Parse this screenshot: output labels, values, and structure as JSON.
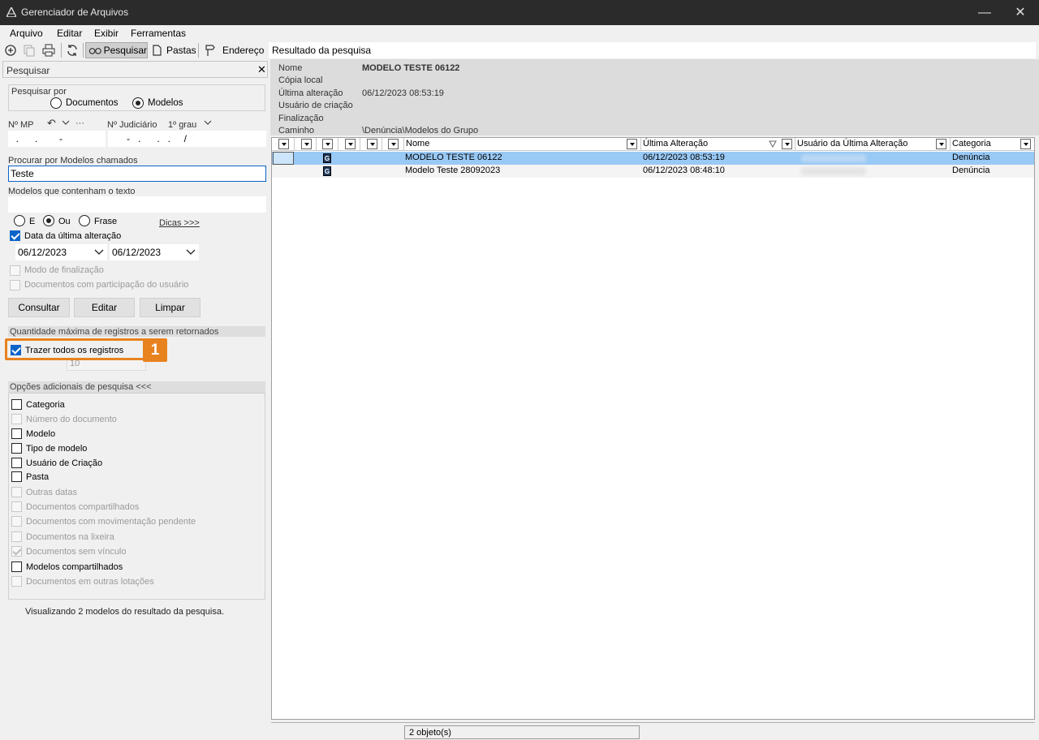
{
  "window": {
    "title": "Gerenciador de Arquivos"
  },
  "menu": [
    "Arquivo",
    "Editar",
    "Exibir",
    "Ferramentas"
  ],
  "toolbar": {
    "pesquisar": "Pesquisar",
    "pastas": "Pastas",
    "endereco": "Endereço",
    "address_value": "Resultado da pesquisa"
  },
  "search": {
    "panel_title": "Pesquisar",
    "search_by_label": "Pesquisar por",
    "radio_documentos": "Documentos",
    "radio_modelos": "Modelos",
    "nmp_label": "Nº MP",
    "nmp_ellipsis": "···",
    "njud_label": "Nº Judiciário",
    "grau": "1º grau",
    "nmp_value": "  .      .        -",
    "njud_value": "      -   .      .   .     /",
    "models_named_label": "Procurar por Modelos chamados",
    "models_named_value": "Teste",
    "text_label": "Modelos que contenham o texto",
    "text_value": "",
    "radio_e": "E",
    "radio_ou": "Ou",
    "radio_frase": "Frase",
    "dicas": "Dicas >>>",
    "date_cb_label": "Data da última alteração",
    "date_from": "06/12/2023",
    "date_to": "06/12/2023",
    "modo_final": "Modo de finalização",
    "docs_participacao": "Documentos com participação do usuário",
    "btn_consultar": "Consultar",
    "btn_editar": "Editar",
    "btn_limpar": "Limpar",
    "max_records_label": "Quantidade máxima de registros a serem retornados",
    "trazer_todos": "Trazer todos os registros",
    "max_value": "10",
    "step_badge": "1",
    "opcoes_header": "Opções adicionais de pesquisa <<<",
    "options": [
      {
        "label": "Categoria",
        "enabled": true,
        "checked": false
      },
      {
        "label": "Número do documento",
        "enabled": false,
        "checked": false
      },
      {
        "label": "Modelo",
        "enabled": true,
        "checked": false
      },
      {
        "label": "Tipo de modelo",
        "enabled": true,
        "checked": false
      },
      {
        "label": "Usuário de Criação",
        "enabled": true,
        "checked": false
      },
      {
        "label": "Pasta",
        "enabled": true,
        "checked": false
      },
      {
        "label": "Outras datas",
        "enabled": false,
        "checked": false
      },
      {
        "label": "Documentos compartilhados",
        "enabled": false,
        "checked": false
      },
      {
        "label": "Documentos com movimentação pendente",
        "enabled": false,
        "checked": false
      },
      {
        "label": "Documentos na lixeira",
        "enabled": false,
        "checked": false
      },
      {
        "label": "Documentos sem vínculo",
        "enabled": false,
        "checked": true
      },
      {
        "label": "Modelos compartilhados",
        "enabled": true,
        "checked": false
      },
      {
        "label": "Documentos em outras lotações",
        "enabled": false,
        "checked": false
      }
    ],
    "result_summary": "Visualizando 2 modelos do resultado da pesquisa."
  },
  "details": {
    "nome_label": "Nome",
    "nome_value": "MODELO TESTE 06122",
    "copia_label": "Cópia local",
    "ultima_label": "Última alteração",
    "ultima_value": "06/12/2023 08:53:19",
    "usuario_label": "Usuário de criação",
    "final_label": "Finalização",
    "caminho_label": "Caminho",
    "caminho_value": "\\Denúncia\\Modelos do Grupo"
  },
  "grid": {
    "headers": {
      "nome": "Nome",
      "ultima": "Última Alteração",
      "usuario": "Usuário da Última Alteração",
      "categoria": "Categoria"
    },
    "rows": [
      {
        "icon": "G",
        "nome": "MODELO TESTE 06122",
        "ultima": "06/12/2023 08:53:19",
        "categoria": "Denúncia",
        "selected": true
      },
      {
        "icon": "G",
        "nome": "Modelo Teste 28092023",
        "ultima": "06/12/2023 08:48:10",
        "categoria": "Denúncia",
        "selected": false
      }
    ]
  },
  "status": {
    "count": "2 objeto(s)"
  },
  "colors": {
    "titlebar": "#2b2b2b",
    "selected_row": "#99c9f5",
    "accent": "#0a64c8",
    "highlight": "#e8821e"
  }
}
